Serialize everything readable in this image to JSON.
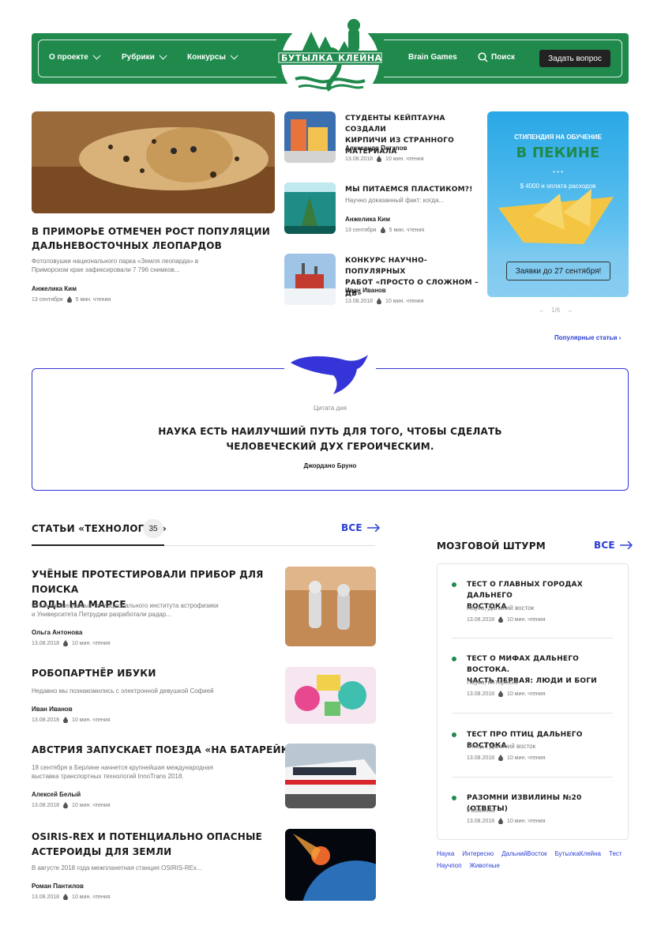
{
  "header": {
    "nav": [
      {
        "label": "О проекте"
      },
      {
        "label": "Рубрики"
      },
      {
        "label": "Конкурсы"
      }
    ],
    "brain_games": "Brain Games",
    "search": "Поиск",
    "ask": "Задать вопрос",
    "logo_left": "БУТЫЛКА",
    "logo_right": "КЛЕЙНА"
  },
  "featured": {
    "title": "В Приморье отмечен рост популяции дальневосточных леопардов",
    "title_l1": "В Приморье отмечен рост популяции",
    "title_l2": "дальневосточных леопардов",
    "excerpt_l1": "Фотоловушки национального парка «Земля леопарда» в",
    "excerpt_l2": "Приморском крае зафиксировали 7 796 снимков...",
    "author": "Анжелика Ким",
    "date": "13 сентября",
    "read": "5 мин. чтения"
  },
  "side_articles": [
    {
      "title_l1": "Студенты Кейптауна создали",
      "title_l2": "кирпичи из странного материала",
      "excerpt": "",
      "author": "Александр Потапов",
      "date": "13.08.2018",
      "read": "10 мин. чтения"
    },
    {
      "title_l1": "Мы питаемся пластиком?!",
      "title_l2": "",
      "excerpt": "Научно доказанный факт: когда...",
      "author": "Анжелика Ким",
      "date": "13 сентября",
      "read": "5 мин. чтения"
    },
    {
      "title_l1": "Конкурс научно-популярных",
      "title_l2": "работ «Просто о сложном – ДВ»",
      "excerpt": "",
      "author": "Иван Иванов",
      "date": "13.08.2018",
      "read": "10 мин. чтения"
    }
  ],
  "promo": {
    "line1": "Стипендия на обучение",
    "line2": "в Пекине",
    "dots": "• • •",
    "amount": "$ 4000 и оплата расходов",
    "button": "Заявки до 27 сентября!",
    "pager": "1/6"
  },
  "popular_link": "Популярные статьи",
  "quote": {
    "label": "Цитата дня",
    "line1": "Наука есть наилучший путь для того, чтобы сделать",
    "line2": "человеческий дух героическим.",
    "author": "Джордано Бруно"
  },
  "tech_section": {
    "title": "Статьи «Технологии»",
    "count": "35",
    "all": "Все",
    "articles": [
      {
        "title_l1": "Учёные протестировали прибор для поиска",
        "title_l2": "воды на Марсе",
        "excerpt_l1": "Итальянские учёные из Национального института астрофизики",
        "excerpt_l2": "и Университета Петруджи разработали радар...",
        "author": "Ольга Антонова",
        "date": "13.08.2018",
        "read": "10 мин. чтения"
      },
      {
        "title_l1": "Робопартнёр Ибуки",
        "title_l2": "",
        "excerpt_l1": "Недавно мы познакомились с электронной девушкой Софией",
        "excerpt_l2": "",
        "author": "Иван Иванов",
        "date": "13.08.2018",
        "read": "10 мин. чтения"
      },
      {
        "title_l1": "Австрия запускает поезда «на батарейках»",
        "title_l2": "",
        "excerpt_l1": "18 сентября в Берлине начнется крупнейшая международная",
        "excerpt_l2": "выставка транспортных технологий InnoTrans 2018.",
        "author": "Алексей Белый",
        "date": "13.08.2018",
        "read": "10 мин. чтения"
      },
      {
        "title_l1": "OSIRIS-REx и потенциально опасные",
        "title_l2": "астероиды для Земли",
        "excerpt_l1": "В августе 2018 года межпланетная станция OSIRIS-REx...",
        "excerpt_l2": "",
        "author": "Роман Пантилов",
        "date": "13.08.2018",
        "read": "10 мин. чтения"
      }
    ]
  },
  "brainstorm": {
    "title": "Мозговой штурм",
    "all": "Все",
    "items": [
      {
        "title_l1": "Тест о главных городах Дальнего",
        "title_l2": "Востока",
        "cats": "Наука, Дальний восток",
        "date": "13.08.2018",
        "read": "10 мин. чтения"
      },
      {
        "title_l1": "Тест о мифах Дальнего Востока.",
        "title_l2": "Часть первая: люди и боги",
        "cats": "Наука, интересно",
        "date": "13.08.2018",
        "read": "10 мин. чтения"
      },
      {
        "title_l1": "Тест про птиц Дальнего Востока",
        "title_l2": "",
        "cats": "Птицы, Дальний восток",
        "date": "13.08.2018",
        "read": "10 мин. чтения"
      },
      {
        "title_l1": "Разомни извилины №20 (ответы)",
        "title_l2": "",
        "cats": "Разминка",
        "date": "13.08.2018",
        "read": "10 мин. чтения"
      }
    ]
  },
  "tags": [
    "Наука",
    "Интересно",
    "ДальнийВосток",
    "БутылкаКлейна",
    "Тест",
    "Научпоп",
    "Животные"
  ],
  "colors": {
    "brand_green": "#1f8a4c",
    "accent_blue": "#2b3fd6",
    "quote_border": "#3434d8"
  }
}
